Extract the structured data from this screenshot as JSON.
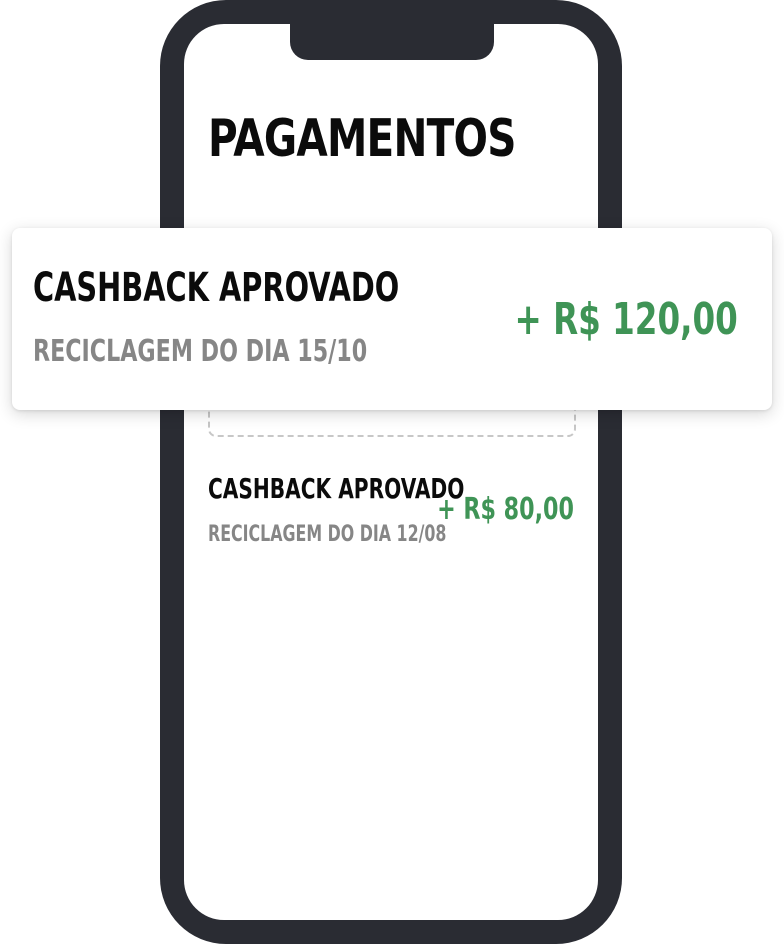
{
  "header": {
    "title": "PAGAMENTOS"
  },
  "featured_payment": {
    "label": "CASHBACK APROVADO",
    "description": "RECICLAGEM DO DIA 15/10",
    "amount": "+ R$ 120,00"
  },
  "payments": [
    {
      "label": "CASHBACK APROVADO",
      "description": "RECICLAGEM DO DIA 12/08",
      "amount": "+ R$ 80,00"
    }
  ],
  "colors": {
    "phone_frame": "#2a2c33",
    "screen": "#ffffff",
    "primary_text": "#0b0b0b",
    "secondary_text": "#868686",
    "amount_positive": "#3f9456",
    "dashed_border": "#c7c7c7"
  }
}
